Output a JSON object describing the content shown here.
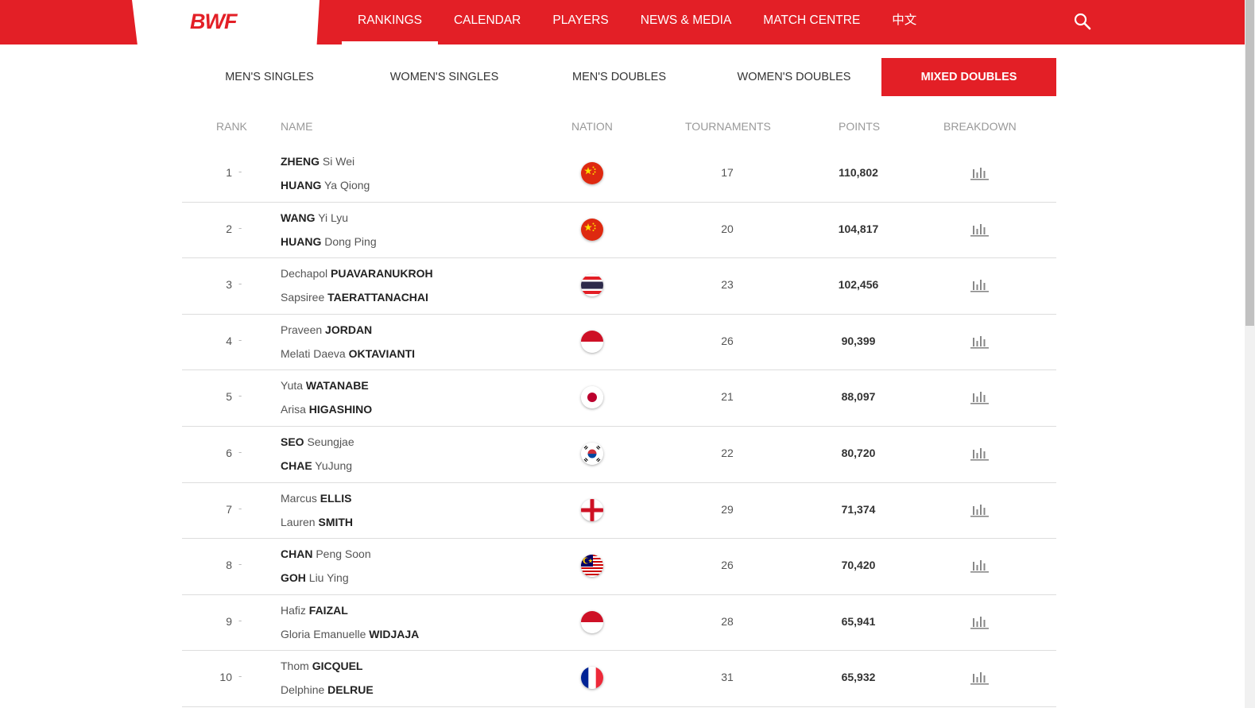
{
  "logo": {
    "text": "BWF"
  },
  "nav": {
    "items": [
      "RANKINGS",
      "CALENDAR",
      "PLAYERS",
      "NEWS & MEDIA",
      "MATCH CENTRE",
      "中文"
    ],
    "active": "RANKINGS"
  },
  "tabs": {
    "items": [
      "MEN'S SINGLES",
      "WOMEN'S SINGLES",
      "MEN'S DOUBLES",
      "WOMEN'S DOUBLES",
      "MIXED DOUBLES"
    ],
    "active": "MIXED DOUBLES"
  },
  "table": {
    "headers": {
      "rank": "RANK",
      "name": "NAME",
      "nation": "NATION",
      "tournaments": "TOURNAMENTS",
      "points": "POINTS",
      "breakdown": "BREAKDOWN"
    },
    "rows": [
      {
        "rank": "1",
        "change": "-",
        "p1_a": "ZHENG",
        "p1_b": " Si Wei",
        "p1_bold_first": true,
        "p2_a": "HUANG",
        "p2_b": " Ya Qiong",
        "p2_bold_first": true,
        "flag": "china-flag",
        "tournaments": "17",
        "points": "110,802"
      },
      {
        "rank": "2",
        "change": "-",
        "p1_a": "WANG",
        "p1_b": " Yi Lyu",
        "p1_bold_first": true,
        "p2_a": "HUANG",
        "p2_b": " Dong Ping",
        "p2_bold_first": true,
        "flag": "china-flag",
        "tournaments": "20",
        "points": "104,817"
      },
      {
        "rank": "3",
        "change": "-",
        "p1_a": "Dechapol ",
        "p1_b": "PUAVARANUKROH",
        "p1_bold_first": false,
        "p2_a": "Sapsiree ",
        "p2_b": "TAERATTANACHAI",
        "p2_bold_first": false,
        "flag": "thailand-flag",
        "tournaments": "23",
        "points": "102,456"
      },
      {
        "rank": "4",
        "change": "-",
        "p1_a": "Praveen ",
        "p1_b": "JORDAN",
        "p1_bold_first": false,
        "p2_a": "Melati Daeva ",
        "p2_b": "OKTAVIANTI",
        "p2_bold_first": false,
        "flag": "indonesia-flag",
        "tournaments": "26",
        "points": "90,399"
      },
      {
        "rank": "5",
        "change": "-",
        "p1_a": "Yuta ",
        "p1_b": "WATANABE",
        "p1_bold_first": false,
        "p2_a": "Arisa ",
        "p2_b": "HIGASHINO",
        "p2_bold_first": false,
        "flag": "japan-flag",
        "tournaments": "21",
        "points": "88,097"
      },
      {
        "rank": "6",
        "change": "-",
        "p1_a": "SEO",
        "p1_b": " Seungjae",
        "p1_bold_first": true,
        "p2_a": "CHAE",
        "p2_b": " YuJung",
        "p2_bold_first": true,
        "flag": "korea-flag",
        "tournaments": "22",
        "points": "80,720"
      },
      {
        "rank": "7",
        "change": "-",
        "p1_a": "Marcus ",
        "p1_b": "ELLIS",
        "p1_bold_first": false,
        "p2_a": "Lauren ",
        "p2_b": "SMITH",
        "p2_bold_first": false,
        "flag": "england-flag",
        "tournaments": "29",
        "points": "71,374"
      },
      {
        "rank": "8",
        "change": "-",
        "p1_a": "CHAN",
        "p1_b": " Peng Soon",
        "p1_bold_first": true,
        "p2_a": "GOH",
        "p2_b": " Liu Ying",
        "p2_bold_first": true,
        "flag": "malaysia-flag",
        "tournaments": "26",
        "points": "70,420"
      },
      {
        "rank": "9",
        "change": "-",
        "p1_a": "Hafiz ",
        "p1_b": "FAIZAL",
        "p1_bold_first": false,
        "p2_a": "Gloria Emanuelle ",
        "p2_b": "WIDJAJA",
        "p2_bold_first": false,
        "flag": "indonesia-flag",
        "tournaments": "28",
        "points": "65,941"
      },
      {
        "rank": "10",
        "change": "-",
        "p1_a": "Thom ",
        "p1_b": "GICQUEL",
        "p1_bold_first": false,
        "p2_a": "Delphine ",
        "p2_b": "DELRUE",
        "p2_bold_first": false,
        "flag": "france-flag",
        "tournaments": "31",
        "points": "65,932"
      }
    ]
  },
  "colors": {
    "brand": "#e31f26"
  }
}
